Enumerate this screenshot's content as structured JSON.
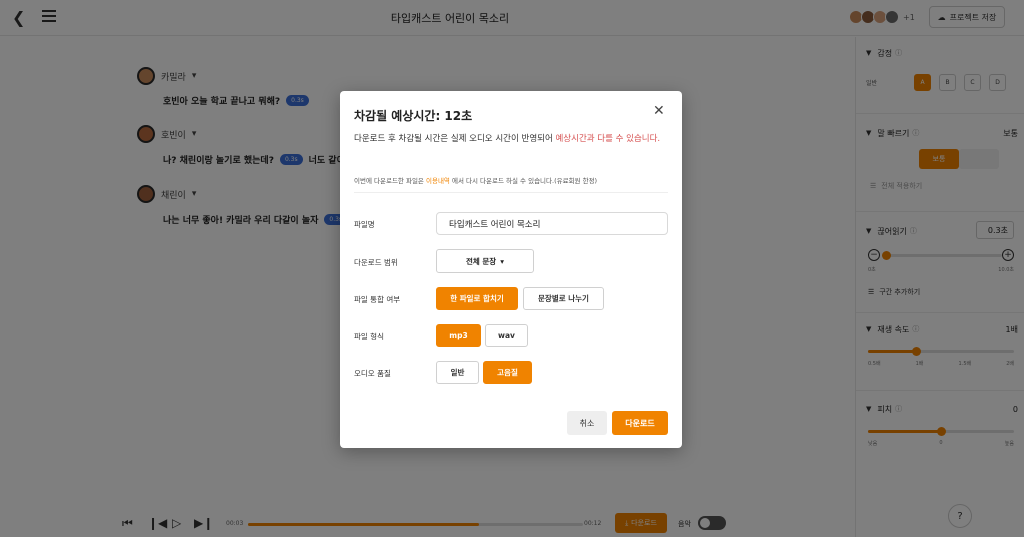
{
  "header": {
    "title": "타입캐스트 어린이 목소리",
    "avatar_more": "+1",
    "project_button": "프로젝트 저장"
  },
  "lines": [
    {
      "speaker": "카밀라",
      "text": "호빈아 오늘 학교 끝나고 뭐해?",
      "time": "0.3s"
    },
    {
      "speaker": "호빈이",
      "text": "나? 채린이랑 놀기로 했는데?",
      "time": "0.3s",
      "extra": "너도 같이"
    },
    {
      "speaker": "채린이",
      "text": "나는 너무 좋아! 카밀라 우리 다같이 놀자",
      "time": "0.3s"
    }
  ],
  "player": {
    "time_start": "00:03",
    "time_end": "00:12",
    "progress": 0.69,
    "download": "다운로드",
    "music_label": "음악"
  },
  "panel": {
    "emotion": {
      "title": "감정",
      "label": "일반",
      "options": [
        "A",
        "B",
        "C",
        "D"
      ],
      "selected": "A"
    },
    "speed": {
      "title": "말 빠르기",
      "value": "보통",
      "seg_on": "보통",
      "apply_all": "전체 적용하기"
    },
    "pause": {
      "title": "끊어읽기",
      "value": "0.3초",
      "ticks": [
        "0초",
        "10.0초"
      ],
      "level": 0.0,
      "add_section": "구간 추가하기"
    },
    "rate": {
      "title": "재생 속도",
      "value": "1배",
      "ticks": [
        "0.5배",
        "1배",
        "1.5배",
        "2배"
      ],
      "level": 0.33
    },
    "pitch": {
      "title": "피치",
      "value": "0",
      "ticks": [
        "낮음",
        "0",
        "높음"
      ],
      "level": 0.5
    },
    "help": "?"
  },
  "modal": {
    "title": "차감될 예상시간: 12초",
    "desc_part1": "다운로드 후 차감될 시간은 실제 오디오 시간이 반영되어 ",
    "desc_accent": "예상시간과 다를 수 있습니다.",
    "note_part1": "이번에 다운로드한 파일은 ",
    "note_highlight": "이용내역",
    "note_part2": " 에서 다시 다운로드 하실 수 있습니다.(유료회원 한정)",
    "filename_label": "파일명",
    "filename_value": "타입캐스트 어린이 목소리",
    "range_label": "다운로드 범위",
    "range_value": "전체 문장",
    "merge_label": "파일 통합 여부",
    "merge_options": [
      "한 파일로 합치기",
      "문장별로 나누기"
    ],
    "merge_selected": 0,
    "format_label": "파일 형식",
    "format_options": [
      "mp3",
      "wav"
    ],
    "format_selected": 0,
    "quality_label": "오디오 품질",
    "quality_options": [
      "일반",
      "고음질"
    ],
    "quality_selected": 1,
    "cancel": "취소",
    "download": "다운로드"
  }
}
